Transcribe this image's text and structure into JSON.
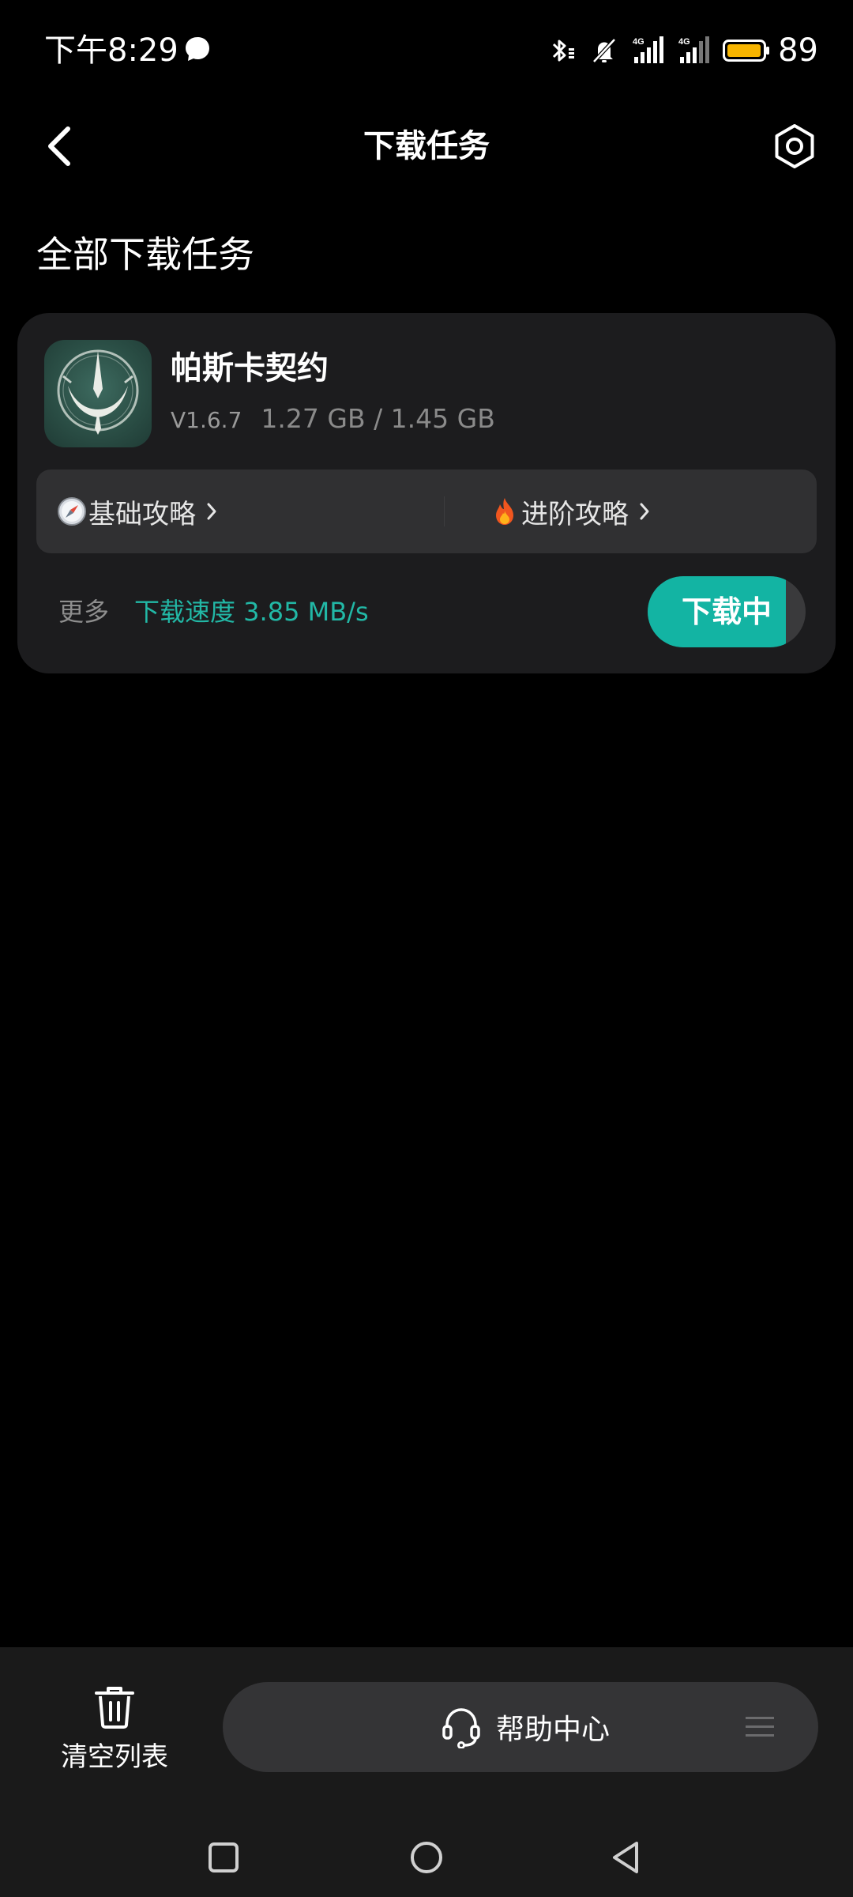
{
  "status_bar": {
    "time": "下午8:29",
    "battery": "89",
    "icons": [
      "chat-bubble-icon",
      "bluetooth-icon",
      "mute-bell-icon",
      "signal-4g-icon",
      "signal-4g-icon",
      "battery-icon"
    ]
  },
  "header": {
    "title": "下载任务",
    "back_icon": "chevron-left-icon",
    "settings_icon": "hexagon-settings-icon"
  },
  "section": {
    "title": "全部下载任务"
  },
  "task": {
    "app_name": "帕斯卡契约",
    "version": "V1.6.7",
    "size": "1.27 GB / 1.45 GB",
    "guides": [
      {
        "label": "基础攻略",
        "icon": "compass-icon"
      },
      {
        "label": "进阶攻略",
        "icon": "fire-icon"
      }
    ],
    "more_label": "更多",
    "speed": "下载速度 3.85 MB/s",
    "button_label": "下载中",
    "progress": 0.876
  },
  "bottom": {
    "clear_label": "清空列表",
    "help_label": "帮助中心"
  },
  "colors": {
    "accent": "#13b4a3",
    "speed_text": "#22b8a6",
    "card_bg": "#1c1c1e",
    "guide_bg": "#303032",
    "bottom_bg": "#1a1a1a"
  }
}
